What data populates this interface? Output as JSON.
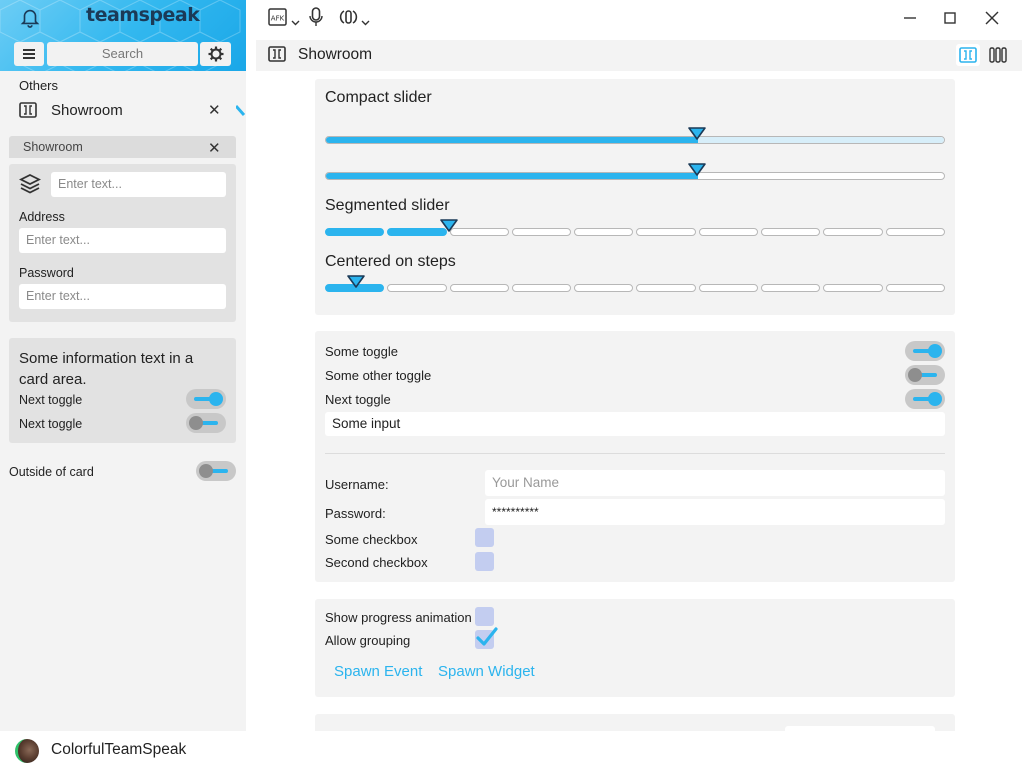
{
  "colors": {
    "accent": "#2bb4ee",
    "panel": "#f3f3f3",
    "card": "#e2e2e2"
  },
  "header": {
    "brand": "teamspeak",
    "search_placeholder": "Search",
    "afk_label": "AFK"
  },
  "sidebar": {
    "group_label": "Others",
    "server_item": {
      "label": "Showroom",
      "close": "✕"
    },
    "panel": {
      "title": "Showroom",
      "close": "✕",
      "name_placeholder": "Enter text...",
      "address_label": "Address",
      "address_placeholder": "Enter text...",
      "password_label": "Password",
      "password_placeholder": "Enter text..."
    },
    "info_card": {
      "text": "Some information text in a card area.",
      "toggles": [
        {
          "label": "Next toggle",
          "on": true
        },
        {
          "label": "Next toggle",
          "on": false
        }
      ]
    },
    "outside_toggle": {
      "label": "Outside of card",
      "on": false
    }
  },
  "status": {
    "username": "ColorfulTeamSpeak"
  },
  "tab": {
    "title": "Showroom"
  },
  "sliders_card": {
    "compact_title": "Compact slider",
    "compact_values": [
      0.6,
      0.6
    ],
    "segmented_title": "Segmented slider",
    "segmented": {
      "segments": 10,
      "filled": 2
    },
    "centered_title": "Centered on steps",
    "centered": {
      "segments": 10,
      "filled": 1,
      "thumb_step": 0.5
    }
  },
  "form_card": {
    "toggles": [
      {
        "label": "Some toggle",
        "on": true
      },
      {
        "label": "Some other toggle",
        "on": false
      },
      {
        "label": "Next toggle",
        "on": true
      }
    ],
    "input_value": "Some input",
    "username_label": "Username:",
    "username_placeholder": "Your Name",
    "password_label": "Password:",
    "password_value": "**********",
    "checkboxes": [
      {
        "label": "Some checkbox",
        "checked": false
      },
      {
        "label": "Second checkbox",
        "checked": false
      }
    ]
  },
  "actions_card": {
    "checkboxes": [
      {
        "label": "Show progress animation",
        "checked": false
      },
      {
        "label": "Allow grouping",
        "checked": true
      }
    ],
    "spawn_event": "Spawn Event",
    "spawn_widget": "Spawn Widget"
  }
}
